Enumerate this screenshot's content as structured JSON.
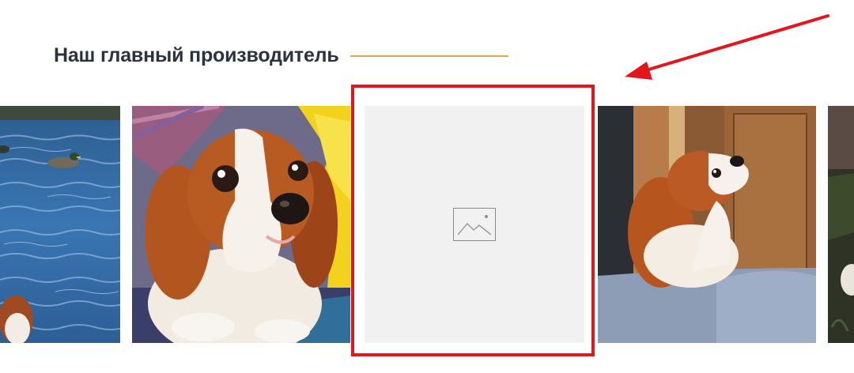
{
  "section": {
    "title": "Наш главный производитель"
  },
  "colors": {
    "title": "#2b3340",
    "title_underline": "#e3a64a",
    "highlight": "#e5151c",
    "placeholder_bg": "#f1f1f1"
  },
  "carousel": {
    "slides": [
      {
        "subject": "ducks on water"
      },
      {
        "subject": "cavalier spaniel close-up"
      },
      {
        "subject": "missing image placeholder",
        "icon": "image-placeholder-icon"
      },
      {
        "subject": "spaniel looking up"
      },
      {
        "subject": "partial image"
      }
    ]
  },
  "annotation": {
    "type": "red-box-and-arrow"
  }
}
